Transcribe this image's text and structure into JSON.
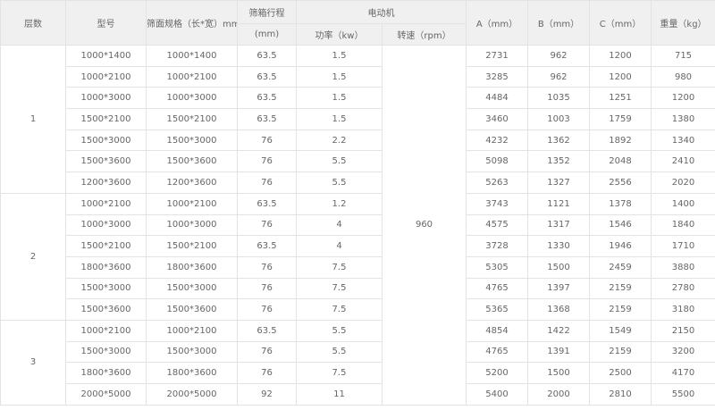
{
  "headers": {
    "layers": "层数",
    "model": "型号",
    "screen_spec": "筛面规格（长*宽）mm",
    "stroke": "筛箱行程",
    "stroke_unit": "(mm)",
    "motor": "电动机",
    "power": "功率（kw）",
    "speed": "转速（rpm）",
    "a": "A（mm）",
    "b": "B（mm）",
    "c": "C（mm）",
    "weight": "重量（kg）"
  },
  "speed_value": "960",
  "groups": [
    {
      "layer": "1",
      "rows": [
        {
          "model": "1000*1400",
          "screen": "1000*1400",
          "stroke": "63.5",
          "power": "1.5",
          "a": "2731",
          "b": "962",
          "c": "1200",
          "weight": "715"
        },
        {
          "model": "1000*2100",
          "screen": "1000*2100",
          "stroke": "63.5",
          "power": "1.5",
          "a": "3285",
          "b": "962",
          "c": "1200",
          "weight": "980"
        },
        {
          "model": "1000*3000",
          "screen": "1000*3000",
          "stroke": "63.5",
          "power": "1.5",
          "a": "4484",
          "b": "1035",
          "c": "1251",
          "weight": "1200"
        },
        {
          "model": "1500*2100",
          "screen": "1500*2100",
          "stroke": "63.5",
          "power": "1.5",
          "a": "3460",
          "b": "1003",
          "c": "1759",
          "weight": "1380"
        },
        {
          "model": "1500*3000",
          "screen": "1500*3000",
          "stroke": "76",
          "power": "2.2",
          "a": "4232",
          "b": "1362",
          "c": "1892",
          "weight": "1340"
        },
        {
          "model": "1500*3600",
          "screen": "1500*3600",
          "stroke": "76",
          "power": "5.5",
          "a": "5098",
          "b": "1352",
          "c": "2048",
          "weight": "2410"
        },
        {
          "model": "1200*3600",
          "screen": "1200*3600",
          "stroke": "76",
          "power": "5.5",
          "a": "5263",
          "b": "1327",
          "c": "2556",
          "weight": "2020"
        }
      ]
    },
    {
      "layer": "2",
      "rows": [
        {
          "model": "1000*2100",
          "screen": "1000*2100",
          "stroke": "63.5",
          "power": "1.2",
          "a": "3743",
          "b": "1121",
          "c": "1378",
          "weight": "1400"
        },
        {
          "model": "1000*3000",
          "screen": "1000*3000",
          "stroke": "76",
          "power": "4",
          "a": "4575",
          "b": "1317",
          "c": "1546",
          "weight": "1840"
        },
        {
          "model": "1500*2100",
          "screen": "1500*2100",
          "stroke": "63.5",
          "power": "4",
          "a": "3728",
          "b": "1330",
          "c": "1946",
          "weight": "1710"
        },
        {
          "model": "1800*3600",
          "screen": "1800*3600",
          "stroke": "76",
          "power": "7.5",
          "a": "5305",
          "b": "1500",
          "c": "2459",
          "weight": "3880"
        },
        {
          "model": "1500*3000",
          "screen": "1500*3000",
          "stroke": "76",
          "power": "7.5",
          "a": "4765",
          "b": "1397",
          "c": "2159",
          "weight": "2780"
        },
        {
          "model": "1500*3600",
          "screen": "1500*3600",
          "stroke": "76",
          "power": "7.5",
          "a": "5365",
          "b": "1368",
          "c": "2159",
          "weight": "3180"
        }
      ]
    },
    {
      "layer": "3",
      "rows": [
        {
          "model": "1000*2100",
          "screen": "1000*2100",
          "stroke": "63.5",
          "power": "5.5",
          "a": "4854",
          "b": "1422",
          "c": "1549",
          "weight": "2150"
        },
        {
          "model": "1500*3000",
          "screen": "1500*3000",
          "stroke": "76",
          "power": "5.5",
          "a": "4765",
          "b": "1391",
          "c": "2159",
          "weight": "3200"
        },
        {
          "model": "1800*3600",
          "screen": "1800*3600",
          "stroke": "76",
          "power": "7.5",
          "a": "5200",
          "b": "1500",
          "c": "2500",
          "weight": "4170"
        },
        {
          "model": "2000*5000",
          "screen": "2000*5000",
          "stroke": "92",
          "power": "11",
          "a": "5400",
          "b": "2000",
          "c": "2810",
          "weight": "5500"
        }
      ]
    }
  ]
}
